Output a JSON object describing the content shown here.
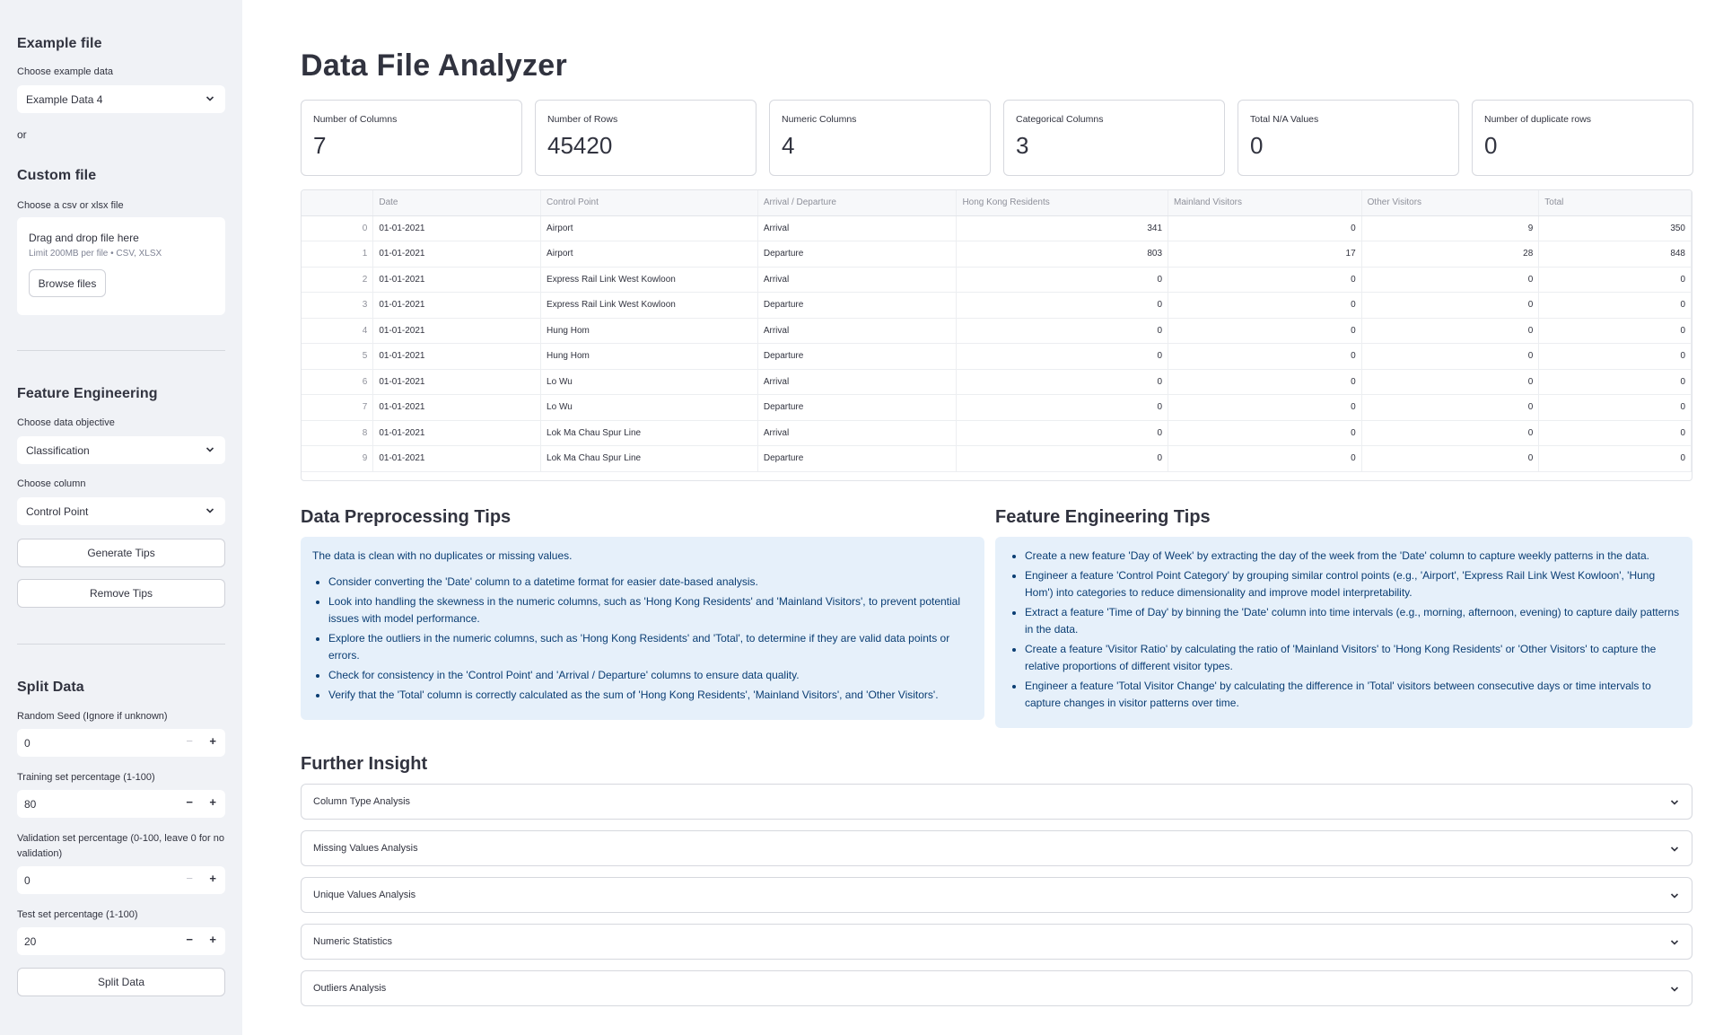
{
  "sidebar": {
    "example_heading": "Example file",
    "example_label": "Choose example data",
    "example_value": "Example Data 4",
    "or_text": "or",
    "custom_heading": "Custom file",
    "custom_label": "Choose a csv or xlsx file",
    "dropzone_title": "Drag and drop file here",
    "dropzone_sub": "Limit 200MB per file • CSV, XLSX",
    "browse_label": "Browse files",
    "fe_heading": "Feature Engineering",
    "objective_label": "Choose data objective",
    "objective_value": "Classification",
    "column_label": "Choose column",
    "column_value": "Control Point",
    "generate_label": "Generate Tips",
    "remove_label": "Remove Tips",
    "split_heading": "Split Data",
    "seed_label": "Random Seed (Ignore if unknown)",
    "seed_value": "0",
    "train_label": "Training set percentage (1-100)",
    "train_value": "80",
    "val_label": "Validation set percentage (0-100, leave 0 for no validation)",
    "val_value": "0",
    "test_label": "Test set percentage (1-100)",
    "test_value": "20",
    "split_button": "Split Data"
  },
  "main": {
    "title": "Data File Analyzer",
    "metrics": [
      {
        "label": "Number of Columns",
        "value": "7"
      },
      {
        "label": "Number of Rows",
        "value": "45420"
      },
      {
        "label": "Numeric Columns",
        "value": "4"
      },
      {
        "label": "Categorical Columns",
        "value": "3"
      },
      {
        "label": "Total N/A Values",
        "value": "0"
      },
      {
        "label": "Number of duplicate rows",
        "value": "0"
      }
    ],
    "table": {
      "headers": [
        "",
        "Date",
        "Control Point",
        "Arrival / Departure",
        "Hong Kong Residents",
        "Mainland Visitors",
        "Other Visitors",
        "Total"
      ],
      "rows": [
        [
          "0",
          "01-01-2021",
          "Airport",
          "Arrival",
          "341",
          "0",
          "9",
          "350"
        ],
        [
          "1",
          "01-01-2021",
          "Airport",
          "Departure",
          "803",
          "17",
          "28",
          "848"
        ],
        [
          "2",
          "01-01-2021",
          "Express Rail Link West Kowloon",
          "Arrival",
          "0",
          "0",
          "0",
          "0"
        ],
        [
          "3",
          "01-01-2021",
          "Express Rail Link West Kowloon",
          "Departure",
          "0",
          "0",
          "0",
          "0"
        ],
        [
          "4",
          "01-01-2021",
          "Hung Hom",
          "Arrival",
          "0",
          "0",
          "0",
          "0"
        ],
        [
          "5",
          "01-01-2021",
          "Hung Hom",
          "Departure",
          "0",
          "0",
          "0",
          "0"
        ],
        [
          "6",
          "01-01-2021",
          "Lo Wu",
          "Arrival",
          "0",
          "0",
          "0",
          "0"
        ],
        [
          "7",
          "01-01-2021",
          "Lo Wu",
          "Departure",
          "0",
          "0",
          "0",
          "0"
        ],
        [
          "8",
          "01-01-2021",
          "Lok Ma Chau Spur Line",
          "Arrival",
          "0",
          "0",
          "0",
          "0"
        ],
        [
          "9",
          "01-01-2021",
          "Lok Ma Chau Spur Line",
          "Departure",
          "0",
          "0",
          "0",
          "0"
        ]
      ]
    },
    "preprocessing": {
      "heading": "Data Preprocessing Tips",
      "intro": "The data is clean with no duplicates or missing values.",
      "tips": [
        "Consider converting the 'Date' column to a datetime format for easier date-based analysis.",
        "Look into handling the skewness in the numeric columns, such as 'Hong Kong Residents' and 'Mainland Visitors', to prevent potential issues with model performance.",
        "Explore the outliers in the numeric columns, such as 'Hong Kong Residents' and 'Total', to determine if they are valid data points or errors.",
        "Check for consistency in the 'Control Point' and 'Arrival / Departure' columns to ensure data quality.",
        "Verify that the 'Total' column is correctly calculated as the sum of 'Hong Kong Residents', 'Mainland Visitors', and 'Other Visitors'."
      ]
    },
    "feature_engineering": {
      "heading": "Feature Engineering Tips",
      "tips": [
        "Create a new feature 'Day of Week' by extracting the day of the week from the 'Date' column to capture weekly patterns in the data.",
        "Engineer a feature 'Control Point Category' by grouping similar control points (e.g., 'Airport', 'Express Rail Link West Kowloon', 'Hung Hom') into categories to reduce dimensionality and improve model interpretability.",
        "Extract a feature 'Time of Day' by binning the 'Date' column into time intervals (e.g., morning, afternoon, evening) to capture daily patterns in the data.",
        "Create a feature 'Visitor Ratio' by calculating the ratio of 'Mainland Visitors' to 'Hong Kong Residents' or 'Other Visitors' to capture the relative proportions of different visitor types.",
        "Engineer a feature 'Total Visitor Change' by calculating the difference in 'Total' visitors between consecutive days or time intervals to capture changes in visitor patterns over time."
      ]
    },
    "further": {
      "heading": "Further Insight",
      "expanders": [
        "Column Type Analysis",
        "Missing Values Analysis",
        "Unique Values Analysis",
        "Numeric Statistics",
        "Outliers Analysis"
      ]
    }
  }
}
